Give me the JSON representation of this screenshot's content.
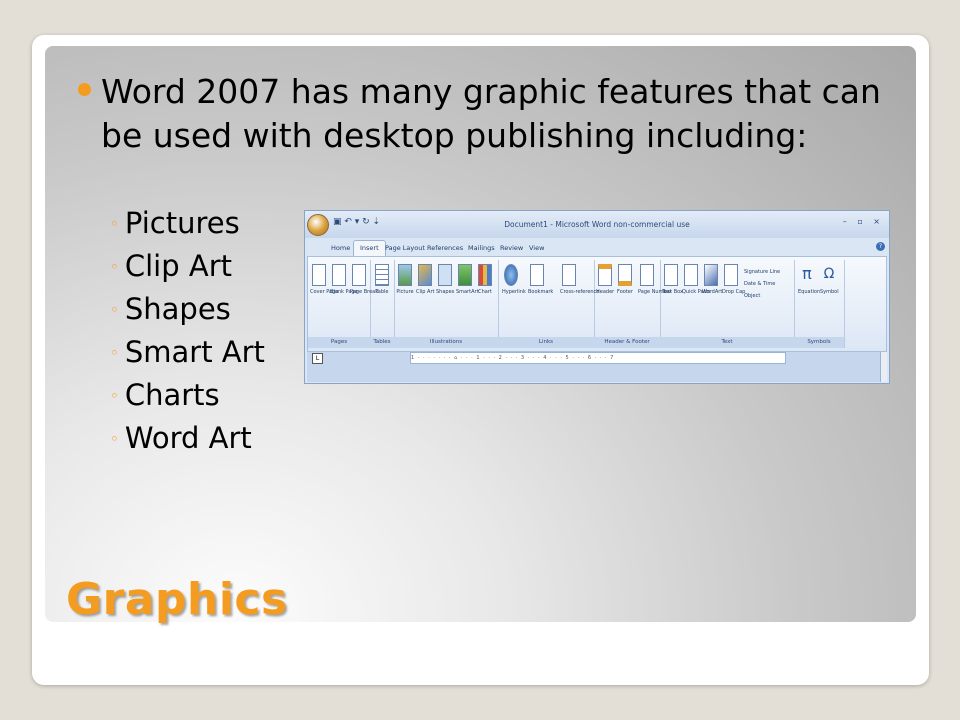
{
  "slide": {
    "title": "Graphics",
    "bullet": "Word 2007 has many graphic features that can be used with desktop publishing including:",
    "subitems": [
      "Pictures",
      "Clip Art",
      "Shapes",
      "Smart Art",
      "Charts",
      "Word Art"
    ],
    "sub_marker": "◦",
    "accent_color": "#f39c1f"
  },
  "ribbon": {
    "window_title": "Document1 - Microsoft Word non-commercial use",
    "quick_access": "▣ ↶ ▾ ↻ ⇣",
    "window_controls": "– ▫ ×",
    "help": "?",
    "tabs": [
      "Home",
      "Insert",
      "Page Layout",
      "References",
      "Mailings",
      "Review",
      "View"
    ],
    "active_tab": "Insert",
    "groups": {
      "pages": {
        "label": "Pages",
        "items": [
          "Cover Page",
          "Blank Page",
          "Page Break"
        ]
      },
      "tables": {
        "label": "Tables",
        "items": [
          "Table"
        ]
      },
      "illustrations": {
        "label": "Illustrations",
        "items": [
          "Picture",
          "Clip Art",
          "Shapes",
          "SmartArt",
          "Chart"
        ]
      },
      "links": {
        "label": "Links",
        "items": [
          "Hyperlink",
          "Bookmark",
          "Cross-reference"
        ]
      },
      "header_footer": {
        "label": "Header & Footer",
        "items": [
          "Header",
          "Footer",
          "Page Number"
        ]
      },
      "text": {
        "label": "Text",
        "items": [
          "Text Box",
          "Quick Parts",
          "WordArt",
          "Drop Cap"
        ],
        "side": [
          "Signature Line",
          "Date & Time",
          "Object"
        ]
      },
      "symbols": {
        "label": "Symbols",
        "items": [
          "Equation",
          "Symbol"
        ]
      }
    },
    "ruler_box": "L",
    "ruler_text": "1 · · · · · · · ⌂ · · · 1 · · · 2 · · · 3 · · · 4 · · · 5 · · · 6 · · · 7"
  }
}
